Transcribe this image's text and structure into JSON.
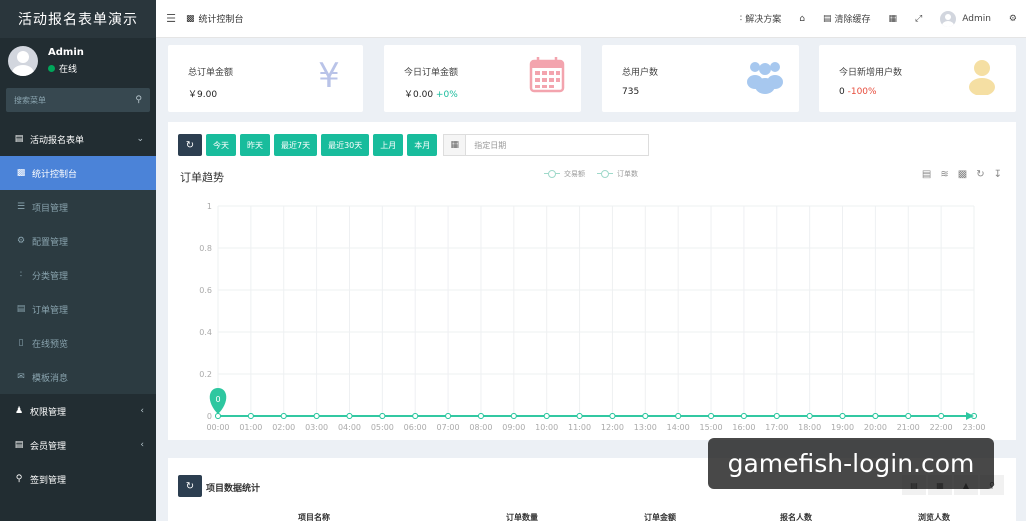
{
  "sidebar": {
    "brand": "活动报名表单演示",
    "user": {
      "name": "Admin",
      "status": "在线"
    },
    "search_placeholder": "搜索菜单",
    "menu": [
      {
        "label": "活动报名表单",
        "icon": "list-icon"
      },
      {
        "label": "统计控制台",
        "icon": "bar-chart-icon",
        "active": true
      },
      {
        "label": "项目管理",
        "icon": "bars-icon"
      },
      {
        "label": "配置管理",
        "icon": "gear-icon"
      },
      {
        "label": "分类管理",
        "icon": "sitemap-icon"
      },
      {
        "label": "订单管理",
        "icon": "file-icon"
      },
      {
        "label": "在线预览",
        "icon": "mobile-icon"
      },
      {
        "label": "模板消息",
        "icon": "envelope-icon"
      },
      {
        "label": "权限管理",
        "icon": "users-icon"
      },
      {
        "label": "会员管理",
        "icon": "list-icon"
      },
      {
        "label": "签到管理",
        "icon": "map-pin-icon"
      }
    ]
  },
  "topbar": {
    "breadcrumb": "统计控制台",
    "solve": "解决方案",
    "clear_cache": "清除缓存",
    "admin": "Admin"
  },
  "stats": [
    {
      "label": "总订单金额",
      "value": "￥9.00",
      "change": ""
    },
    {
      "label": "今日订单金额",
      "value": "￥0.00",
      "change": "+0%"
    },
    {
      "label": "总用户数",
      "value": "735",
      "change": ""
    },
    {
      "label": "今日新增用户数",
      "value": "0",
      "change": "-100%"
    }
  ],
  "filters": {
    "buttons": [
      "今天",
      "昨天",
      "最近7天",
      "最近30天",
      "上月",
      "本月"
    ],
    "date_placeholder": "指定日期"
  },
  "chart_title": "订单趋势",
  "colors": {
    "series_line": "#2ec7a0",
    "button_green": "#18bc9c",
    "button_dark": "#2c3e50",
    "sidebar_active": "#4b83d8"
  },
  "chart_data": {
    "type": "line",
    "title": "订单趋势",
    "x": [
      "00:00",
      "01:00",
      "02:00",
      "03:00",
      "04:00",
      "05:00",
      "06:00",
      "07:00",
      "08:00",
      "09:00",
      "10:00",
      "11:00",
      "12:00",
      "13:00",
      "14:00",
      "15:00",
      "16:00",
      "17:00",
      "18:00",
      "19:00",
      "20:00",
      "21:00",
      "22:00",
      "23:00"
    ],
    "series": [
      {
        "name": "交易额",
        "values": [
          0,
          0,
          0,
          0,
          0,
          0,
          0,
          0,
          0,
          0,
          0,
          0,
          0,
          0,
          0,
          0,
          0,
          0,
          0,
          0,
          0,
          0,
          0,
          0
        ]
      },
      {
        "name": "订单数",
        "values": [
          0,
          0,
          0,
          0,
          0,
          0,
          0,
          0,
          0,
          0,
          0,
          0,
          0,
          0,
          0,
          0,
          0,
          0,
          0,
          0,
          0,
          0,
          0,
          0
        ]
      }
    ],
    "ylim": [
      0,
      1
    ],
    "yticks": [
      "0",
      "0.2",
      "0.4",
      "0.6",
      "0.8",
      "1"
    ],
    "marker_label": "0",
    "grid": true,
    "legend": "top-center"
  },
  "project_stats": {
    "title": "项目数据统计",
    "columns": [
      "项目名称",
      "订单数量",
      "订单金额",
      "报名人数",
      "浏览人数"
    ]
  },
  "watermark": "gamefish-login.com"
}
